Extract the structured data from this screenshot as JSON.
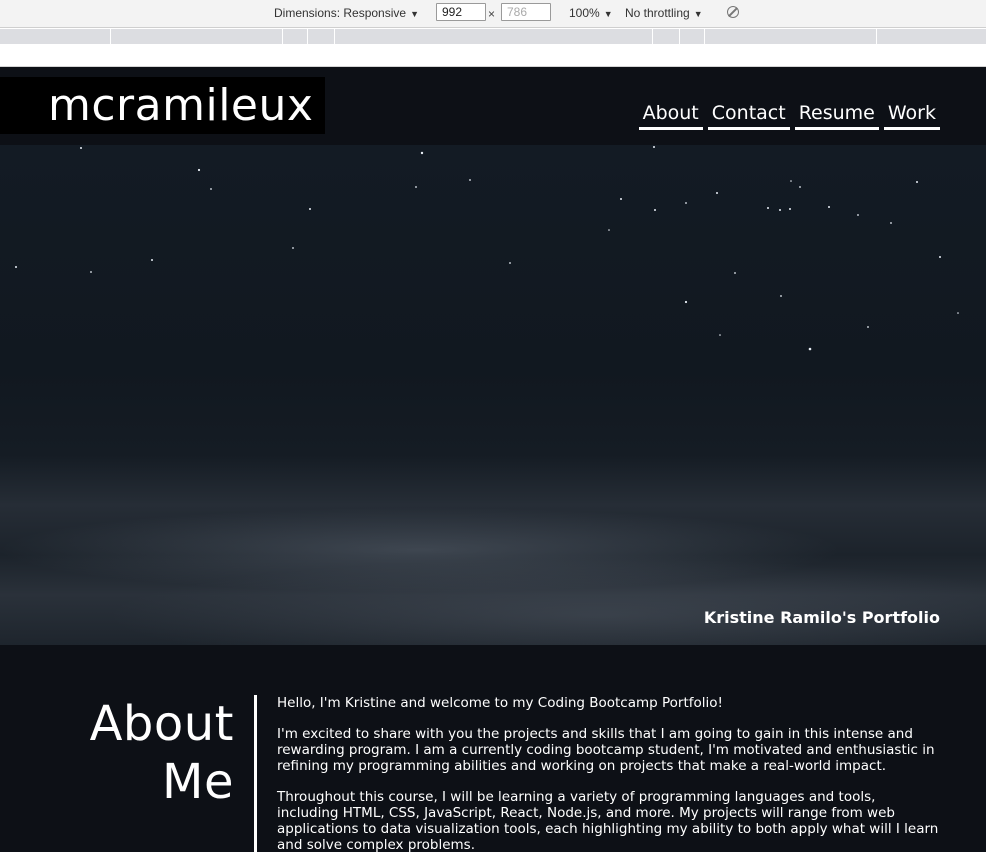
{
  "devtools": {
    "dimensions_label": "Dimensions: Responsive",
    "width_value": "992",
    "height_placeholder": "786",
    "times_symbol": "×",
    "zoom_label": "100%",
    "throttle_label": "No throttling",
    "caret": "▼",
    "rotate_icon": "rotate-icon"
  },
  "header": {
    "logo": "mcramileux",
    "nav": [
      "About",
      "Contact",
      "Resume",
      "Work"
    ]
  },
  "hero": {
    "caption": "Kristine Ramilo's Portfolio"
  },
  "about": {
    "title_line1": "About",
    "title_line2": "Me",
    "paragraphs": [
      "Hello, I'm Kristine and welcome to my Coding Bootcamp Portfolio!",
      "I'm excited to share with you the projects and skills that I am going to gain in this intense and rewarding program. I am a currently coding bootcamp student, I'm motivated and enthusiastic in refining my programming abilities and working on projects that make a real-world impact.",
      "Throughout this course, I will be learning a variety of programming languages and tools, including HTML, CSS, JavaScript, React, Node.js, and more. My projects will range from web applications to data visualization tools, each highlighting my ability to both apply what will I learn and solve complex problems."
    ]
  },
  "colors": {
    "page_bg": "#0d1016",
    "logo_bg": "#000000",
    "text": "#ffffff"
  }
}
